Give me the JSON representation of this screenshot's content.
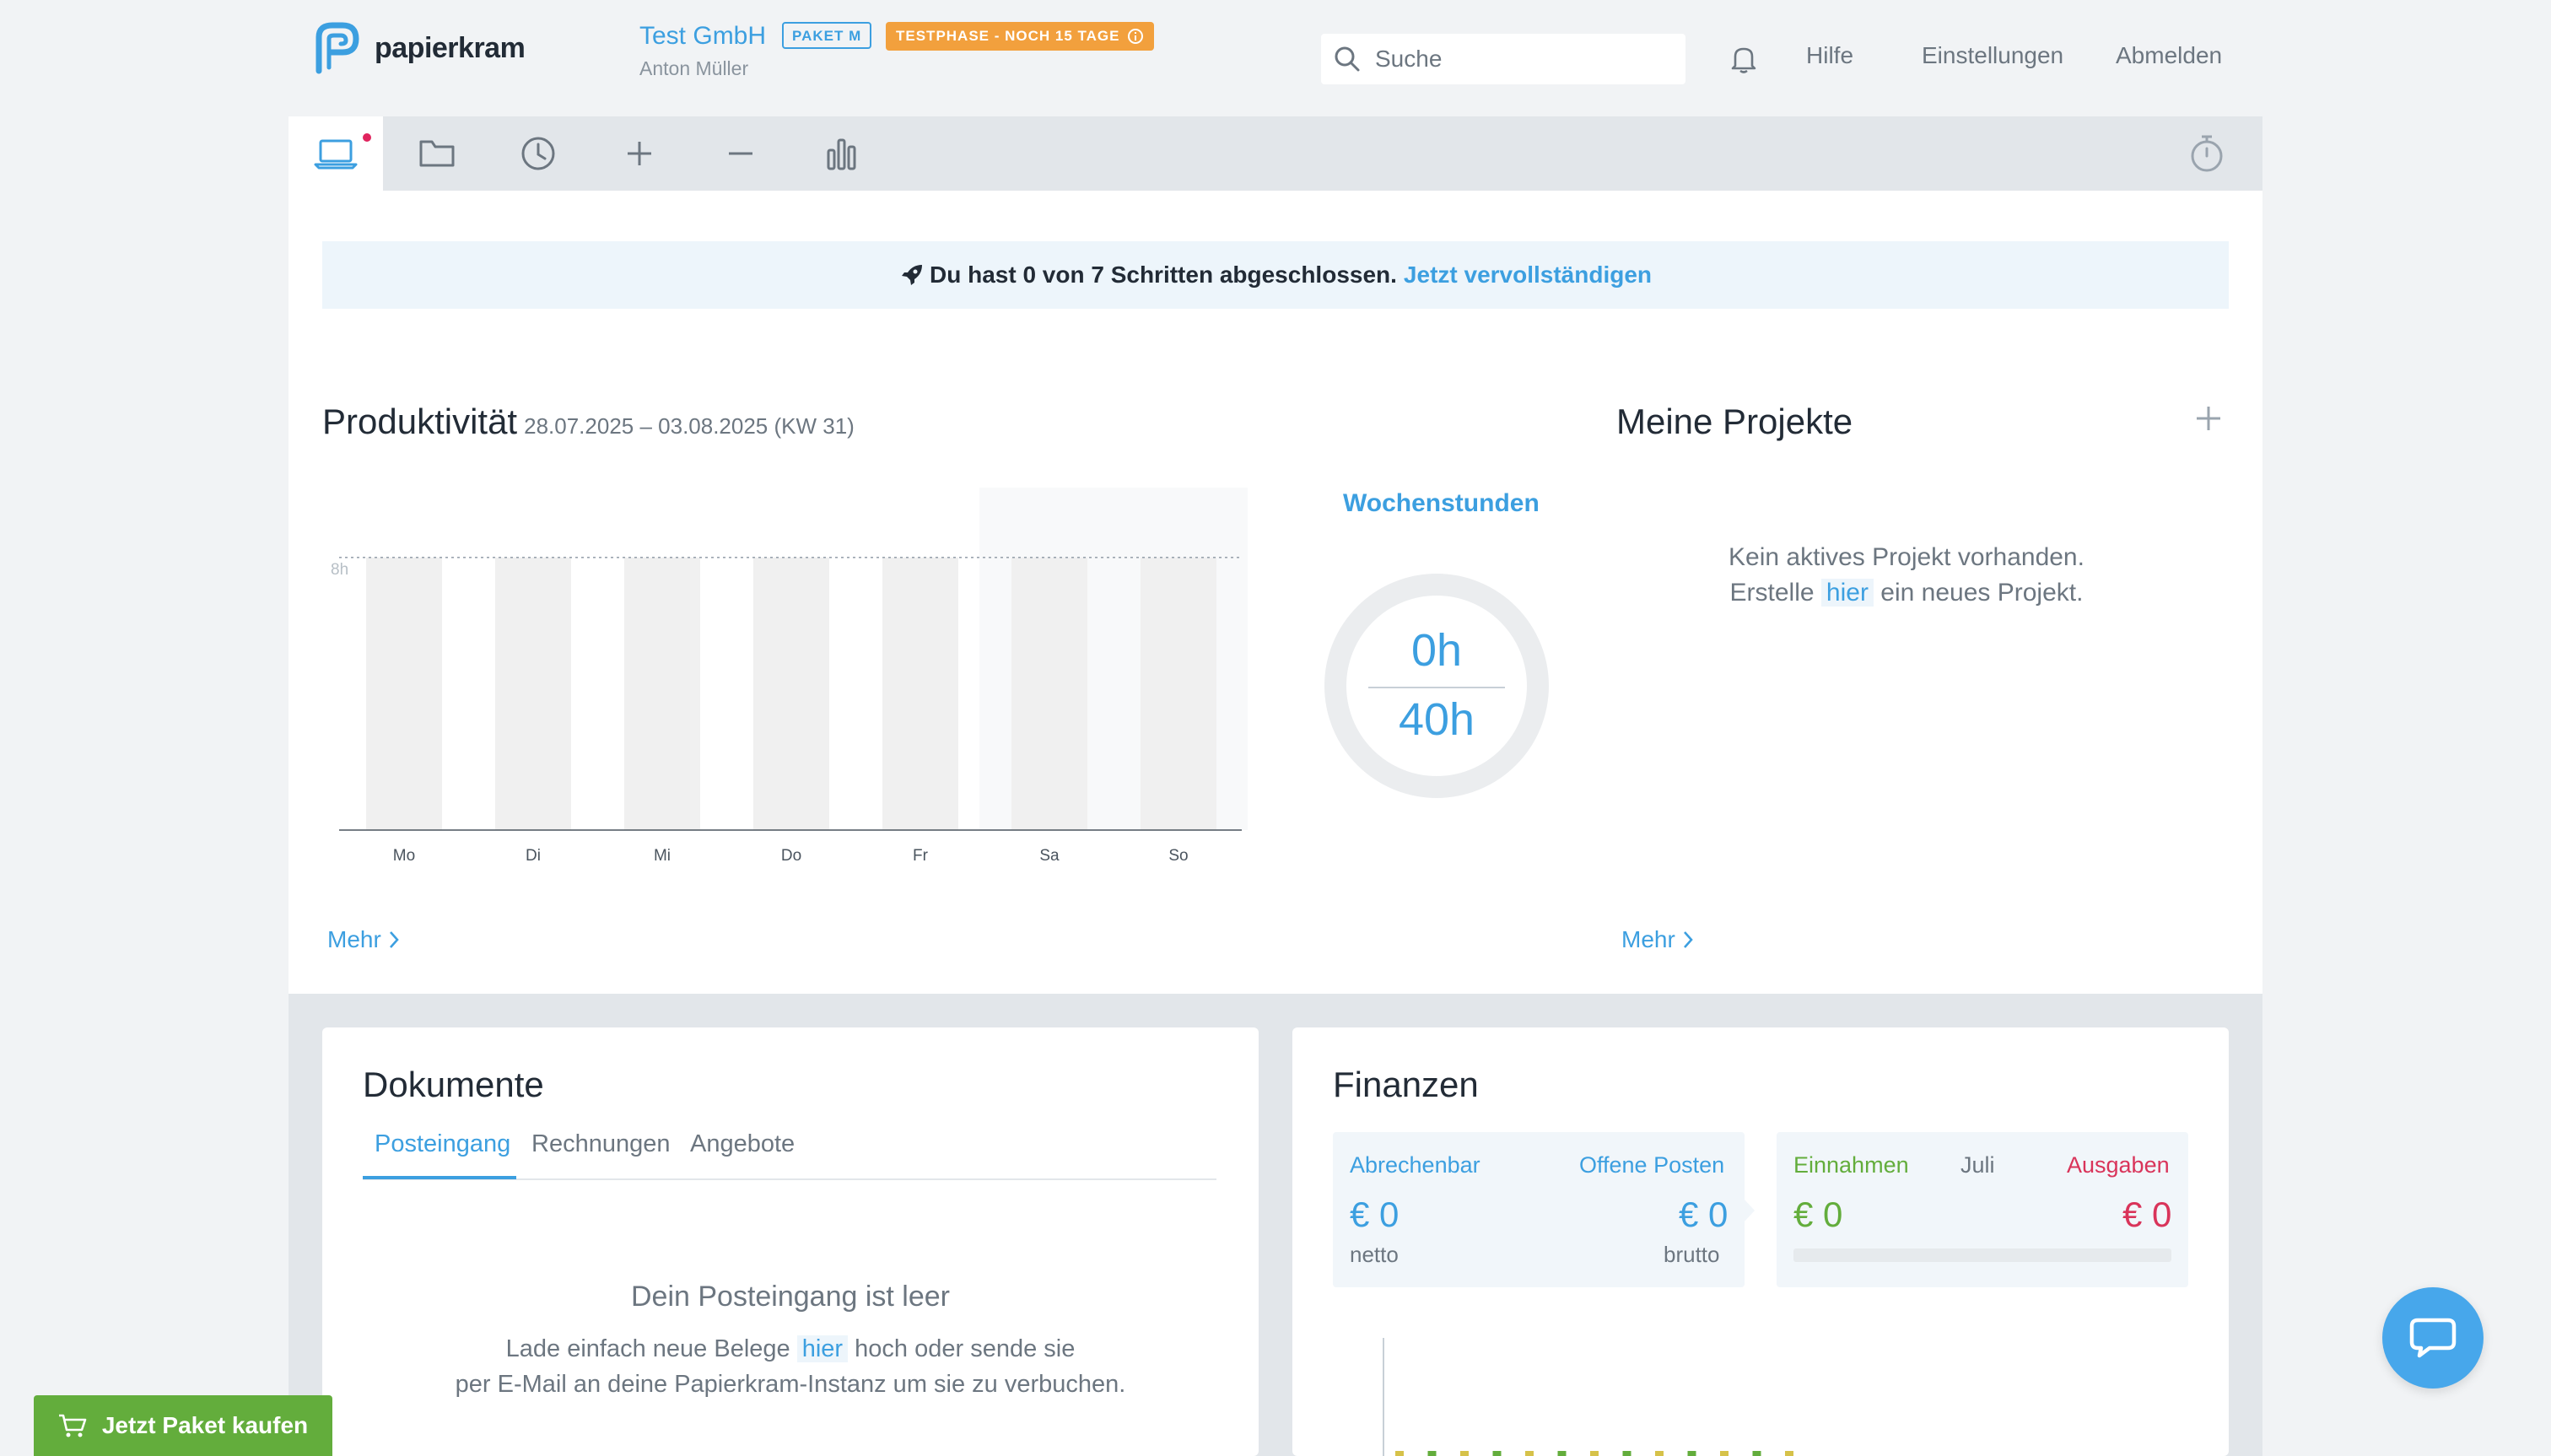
{
  "header": {
    "logo_text": "papierkram",
    "company_name": "Test GmbH",
    "user_name": "Anton Müller",
    "paket_badge": "PAKET M",
    "trial_badge": "TESTPHASE - NOCH 15 TAGE",
    "search_placeholder": "Suche",
    "links": {
      "hilfe": "Hilfe",
      "einstellungen": "Einstellungen",
      "abmelden": "Abmelden"
    }
  },
  "nav": {
    "items": [
      "laptop-icon",
      "folder-icon",
      "clock-icon",
      "plus-icon",
      "minus-icon",
      "bar-chart-icon"
    ],
    "right_item": "stopwatch-icon"
  },
  "banner": {
    "text": "Du hast 0 von 7 Schritten abgeschlossen.",
    "link": "Jetzt vervollständigen"
  },
  "productivity": {
    "title": "Produktivität",
    "range": "28.07.2025 – 03.08.2025 (KW 31)",
    "more": "Mehr"
  },
  "chart_data": {
    "type": "bar",
    "categories": [
      "Mo",
      "Di",
      "Mi",
      "Do",
      "Fr",
      "Sa",
      "So"
    ],
    "values": [
      0,
      0,
      0,
      0,
      0,
      0,
      0
    ],
    "target_line_label": "8h",
    "target": 8,
    "ylim": [
      0,
      10
    ],
    "weekend_shaded": [
      "Sa",
      "So"
    ]
  },
  "week_hours": {
    "label": "Wochenstunden",
    "current": "0h",
    "target": "40h"
  },
  "projects": {
    "title": "Meine Projekte",
    "empty_line1": "Kein aktives Projekt vorhanden.",
    "empty_line2_before": "Erstelle",
    "empty_line2_link": "hier",
    "empty_line2_after": "ein neues Projekt.",
    "more": "Mehr"
  },
  "documents": {
    "title": "Dokumente",
    "tabs": [
      "Posteingang",
      "Rechnungen",
      "Angebote"
    ],
    "empty_title": "Dein Posteingang ist leer",
    "empty_text_before": "Lade einfach neue Belege",
    "empty_text_link": "hier",
    "empty_text_after": "hoch oder sende sie",
    "empty_text_line2": "per E-Mail an deine Papierkram-Instanz um sie zu verbuchen."
  },
  "finances": {
    "title": "Finanzen",
    "abrechenbar_label": "Abrechenbar",
    "abrechenbar_value": "€ 0",
    "abrechenbar_unit": "netto",
    "offene_label": "Offene Posten",
    "offene_value": "€ 0",
    "offene_unit": "brutto",
    "einnahmen_label": "Einnahmen",
    "month_label": "Juli",
    "ausgaben_label": "Ausgaben",
    "einnahmen_value": "€ 0",
    "ausgaben_value": "€ 0"
  },
  "cta": {
    "label": "Jetzt Paket kaufen"
  },
  "colors": {
    "accent": "#3c9fe0",
    "income": "#63ad3c",
    "expense": "#d9345a",
    "trial": "#f2a03d"
  }
}
